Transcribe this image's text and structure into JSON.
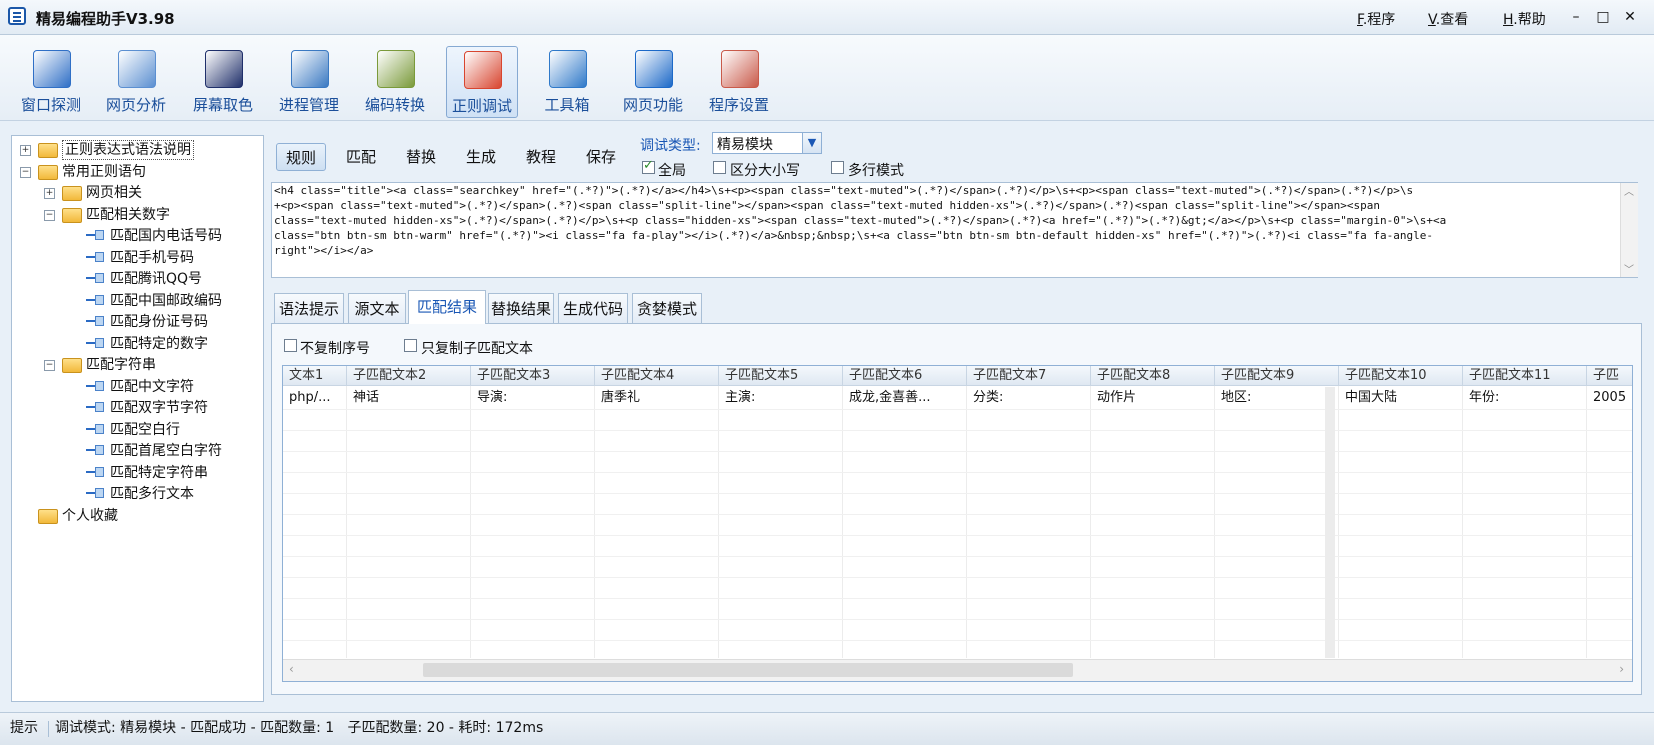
{
  "window": {
    "title": "精易编程助手V3.98"
  },
  "menu": [
    {
      "key": "F",
      "label": ".程序"
    },
    {
      "key": "V",
      "label": ".查看"
    },
    {
      "key": "H",
      "label": ".帮助"
    }
  ],
  "window_controls": {
    "minimize": "–",
    "maximize": "□",
    "close": "✕"
  },
  "toolbar": [
    {
      "label": "窗口探测",
      "icon": "window-probe-icon",
      "color": "#2f6fc6"
    },
    {
      "label": "网页分析",
      "icon": "web-analyze-icon",
      "color": "#5b8fd1"
    },
    {
      "label": "屏幕取色",
      "icon": "color-picker-icon",
      "color": "#1f2f6a"
    },
    {
      "label": "进程管理",
      "icon": "process-icon",
      "color": "#3a79c2"
    },
    {
      "label": "编码转换",
      "icon": "encode-icon",
      "color": "#7a9a3a"
    },
    {
      "label": "正则调试",
      "icon": "regex-debug-icon",
      "color": "#d8452f"
    },
    {
      "label": "工具箱",
      "icon": "toolbox-icon",
      "color": "#2f79c9"
    },
    {
      "label": "网页功能",
      "icon": "globe-icon",
      "color": "#1c69c8"
    },
    {
      "label": "程序设置",
      "icon": "settings-icon",
      "color": "#c95a4a"
    }
  ],
  "tree": [
    {
      "label": "正则表达式语法说明",
      "level": 0,
      "type": "folder",
      "exp": "+"
    },
    {
      "label": "常用正则语句",
      "level": 0,
      "type": "folder",
      "exp": "-"
    },
    {
      "label": "网页相关",
      "level": 1,
      "type": "folder",
      "exp": "+"
    },
    {
      "label": "匹配相关数字",
      "level": 1,
      "type": "folder",
      "exp": "-"
    },
    {
      "label": "匹配国内电话号码",
      "level": 2,
      "type": "leaf"
    },
    {
      "label": "匹配手机号码",
      "level": 2,
      "type": "leaf"
    },
    {
      "label": "匹配腾讯QQ号",
      "level": 2,
      "type": "leaf"
    },
    {
      "label": "匹配中国邮政编码",
      "level": 2,
      "type": "leaf"
    },
    {
      "label": "匹配身份证号码",
      "level": 2,
      "type": "leaf"
    },
    {
      "label": "匹配特定的数字",
      "level": 2,
      "type": "leaf"
    },
    {
      "label": "匹配字符串",
      "level": 1,
      "type": "folder",
      "exp": "-"
    },
    {
      "label": "匹配中文字符",
      "level": 2,
      "type": "leaf"
    },
    {
      "label": "匹配双字节字符",
      "level": 2,
      "type": "leaf"
    },
    {
      "label": "匹配空白行",
      "level": 2,
      "type": "leaf"
    },
    {
      "label": "匹配首尾空白字符",
      "level": 2,
      "type": "leaf"
    },
    {
      "label": "匹配特定字符串",
      "level": 2,
      "type": "leaf"
    },
    {
      "label": "匹配多行文本",
      "level": 2,
      "type": "leaf"
    },
    {
      "label": "个人收藏",
      "level": 0,
      "type": "folder"
    }
  ],
  "action_tabs": [
    "规则",
    "匹配",
    "替换",
    "生成",
    "教程",
    "保存"
  ],
  "debug": {
    "type_label": "调试类型:",
    "type_value": "精易模块",
    "options": [
      {
        "label": "全局",
        "checked": true
      },
      {
        "label": "区分大小写",
        "checked": false
      },
      {
        "label": "多行模式",
        "checked": false
      }
    ]
  },
  "regex_text": "<h4 class=\"title\"><a class=\"searchkey\" href=\"(.*?)\">(.*?)</a></h4>\\s+<p><span class=\"text-muted\">(.*?)</span>(.*?)</p>\\s+<p><span class=\"text-muted\">(.*?)</span>(.*?)</p>\\s\n+<p><span class=\"text-muted\">(.*?)</span>(.*?)<span class=\"split-line\"></span><span class=\"text-muted hidden-xs\">(.*?)</span>(.*?)<span class=\"split-line\"></span><span\nclass=\"text-muted hidden-xs\">(.*?)</span>(.*?)</p>\\s+<p class=\"hidden-xs\"><span class=\"text-muted\">(.*?)</span>(.*?)<a href=\"(.*?)\">(.*?)&gt;</a></p>\\s+<p class=\"margin-0\">\\s+<a\nclass=\"btn btn-sm btn-warm\" href=\"(.*?)\"><i class=\"fa fa-play\"></i>(.*?)</a>&nbsp;&nbsp;\\s+<a class=\"btn btn-sm btn-default hidden-xs\" href=\"(.*?)\">(.*?)<i class=\"fa fa-angle-\nright\"></i></a>",
  "result_tabs": [
    "语法提示",
    "源文本",
    "匹配结果",
    "替换结果",
    "生成代码",
    "贪婪模式"
  ],
  "selected_result_tab": 2,
  "copy_options": [
    {
      "label": "不复制序号",
      "checked": false
    },
    {
      "label": "只复制子匹配文本",
      "checked": false
    }
  ],
  "grid": {
    "columns": [
      "文本1",
      "子匹配文本2",
      "子匹配文本3",
      "子匹配文本4",
      "子匹配文本5",
      "子匹配文本6",
      "子匹配文本7",
      "子匹配文本8",
      "子匹配文本9",
      "子匹配文本10",
      "子匹配文本11",
      "子匹"
    ],
    "rows": [
      [
        "php/...",
        "神话",
        "导演:",
        "唐季礼",
        "主演:",
        "成龙,金喜善...",
        "分类:",
        "动作片",
        "地区:",
        "中国大陆",
        "年份:",
        "2005"
      ]
    ]
  },
  "status": {
    "label": "提示",
    "text": "调试模式: 精易模块 - 匹配成功 - 匹配数量: 1   子匹配数量: 20 - 耗时: 172ms"
  }
}
